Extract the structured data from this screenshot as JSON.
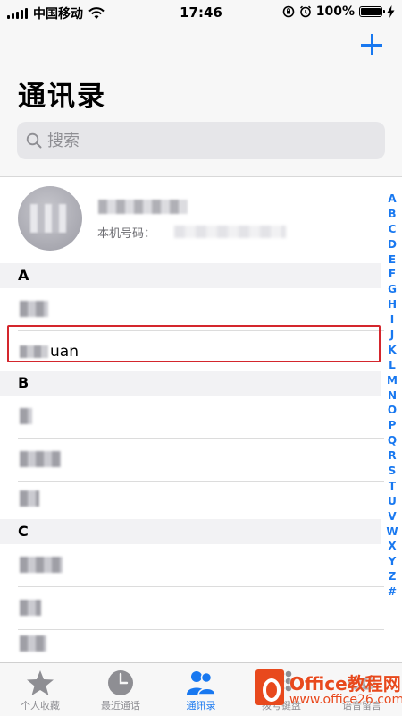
{
  "status_bar": {
    "carrier": "中国移动",
    "time": "17:46",
    "battery": "100%"
  },
  "header": {
    "title": "通讯录",
    "add_icon": "plus-icon"
  },
  "search": {
    "placeholder": "搜索"
  },
  "my_card": {
    "phone_label": "本机号码："
  },
  "sections": [
    {
      "letter": "A"
    },
    {
      "letter": "B"
    },
    {
      "letter": "C"
    }
  ],
  "highlighted_contact": {
    "visible_text": "uan"
  },
  "index_bar": [
    "A",
    "B",
    "C",
    "D",
    "E",
    "F",
    "G",
    "H",
    "I",
    "J",
    "K",
    "L",
    "M",
    "N",
    "O",
    "P",
    "Q",
    "R",
    "S",
    "T",
    "U",
    "V",
    "W",
    "X",
    "Y",
    "Z",
    "#"
  ],
  "tabs": [
    {
      "label": "个人收藏",
      "icon": "star-icon"
    },
    {
      "label": "最近通话",
      "icon": "clock-icon"
    },
    {
      "label": "通讯录",
      "icon": "contacts-icon",
      "active": true
    },
    {
      "label": "拨号键盘",
      "icon": "keypad-icon"
    },
    {
      "label": "语音留言",
      "icon": "voicemail-icon"
    }
  ],
  "watermark": {
    "line1": "Office教程网",
    "line2": "www.office26.com"
  },
  "colors": {
    "accent": "#1878f0",
    "highlight": "#d4262d",
    "watermark": "#e8491d"
  }
}
